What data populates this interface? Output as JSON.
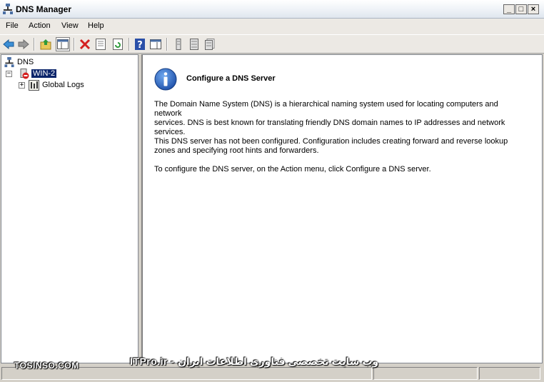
{
  "window": {
    "title": "DNS Manager",
    "minimize": "_",
    "maximize": "□",
    "close": "×"
  },
  "menu": {
    "items": [
      "File",
      "Action",
      "View",
      "Help"
    ]
  },
  "toolbar": {
    "icons": [
      "back-icon",
      "forward-icon",
      "up-folder-icon",
      "show-hide-console-tree-icon",
      "delete-icon",
      "properties-icon",
      "refresh-icon",
      "help-icon",
      "action-pane-icon",
      "server-small-icon",
      "server-medium-icon",
      "server-large-icon"
    ]
  },
  "tree": {
    "root": "DNS",
    "server": "WIN-2",
    "server_expander": "−",
    "child": "Global Logs",
    "child_expander": "+"
  },
  "content": {
    "heading": "Configure a DNS Server",
    "para1_line1": "The Domain Name System (DNS) is a hierarchical naming system used for locating computers and network",
    "para1_line2": "services. DNS is best known for translating friendly DNS domain names to IP addresses and network",
    "para1_line3": "services.",
    "para2_line1": "This DNS server has not been configured. Configuration includes creating forward and reverse lookup",
    "para2_line2": "zones and specifying root hints and forwarders.",
    "para3_line1": "To configure the DNS server, on the Action menu, click Configure a DNS server."
  },
  "watermark": {
    "left": "TOSINSO.COM",
    "center": "ITPro.ir - وب سایت تخصصی فناوری اطلاعات ایران"
  },
  "colors": {
    "selection": "#0a246a",
    "info_blue": "#1d5fbf",
    "delete_red": "#d42020"
  }
}
